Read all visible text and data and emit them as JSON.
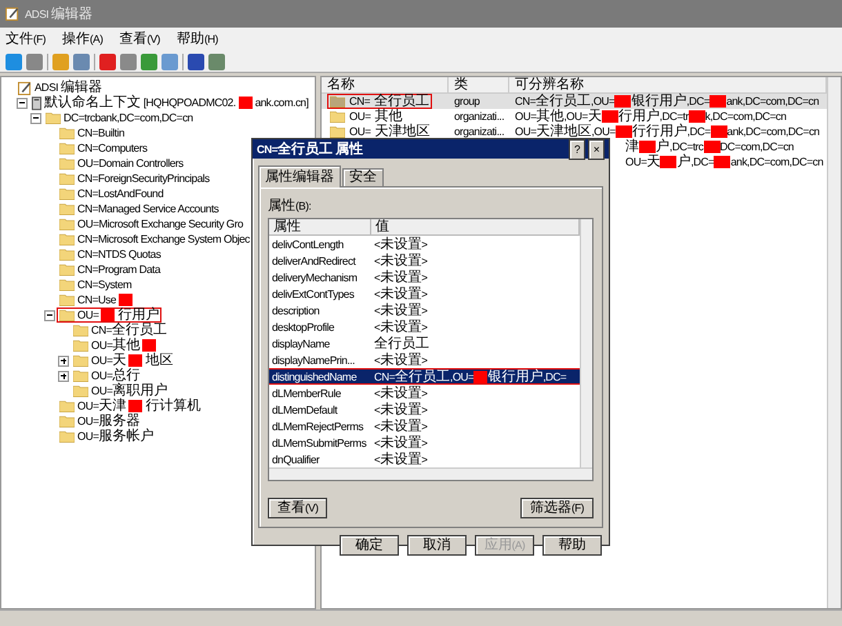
{
  "window": {
    "title": "ADSI 编辑器"
  },
  "menu": [
    "文件(F)",
    "操作(A)",
    "查看(V)",
    "帮助(H)"
  ],
  "tree": {
    "label": [
      "ADSI 编辑器"
    ],
    "kind": "root",
    "children": [
      {
        "label": [
          "默认命名上下文 [HQHQPOADMC02.",
          "ank.com.cn]"
        ],
        "kind": "server",
        "expanded": true,
        "children": [
          {
            "label": [
              "DC=trcbank,DC=com,DC=cn"
            ],
            "kind": "folder",
            "expanded": true,
            "children": [
              {
                "label": [
                  "CN=Builtin"
                ],
                "kind": "folder"
              },
              {
                "label": [
                  "CN=Computers"
                ],
                "kind": "folder"
              },
              {
                "label": [
                  "OU=Domain Controllers"
                ],
                "kind": "folder"
              },
              {
                "label": [
                  "CN=ForeignSecurityPrincipals"
                ],
                "kind": "folder"
              },
              {
                "label": [
                  "CN=LostAndFound"
                ],
                "kind": "folder"
              },
              {
                "label": [
                  "CN=Managed Service Accounts"
                ],
                "kind": "folder"
              },
              {
                "label": [
                  "OU=Microsoft Exchange Security Gro"
                ],
                "kind": "folder"
              },
              {
                "label": [
                  "CN=Microsoft Exchange System Objec"
                ],
                "kind": "folder"
              },
              {
                "label": [
                  "CN=NTDS Quotas"
                ],
                "kind": "folder"
              },
              {
                "label": [
                  "CN=Program Data"
                ],
                "kind": "folder"
              },
              {
                "label": [
                  "CN=System"
                ],
                "kind": "folder"
              },
              {
                "label": [
                  "CN=Use"
                ],
                "redacted_tail": true,
                "kind": "folder"
              },
              {
                "label": [
                  "OU=",
                  "行用户"
                ],
                "kind": "folder",
                "expanded": true,
                "outlined": true,
                "children": [
                  {
                    "label": [
                      "CN=全行员工"
                    ],
                    "kind": "folder"
                  },
                  {
                    "label": [
                      "OU=其他"
                    ],
                    "redacted_tail": true,
                    "kind": "folder"
                  },
                  {
                    "label": [
                      "OU=天",
                      "地区"
                    ],
                    "kind": "folder",
                    "expanded": false
                  },
                  {
                    "label": [
                      "OU=总行"
                    ],
                    "kind": "folder",
                    "expanded": false
                  },
                  {
                    "label": [
                      "OU=离职用户"
                    ],
                    "kind": "folder"
                  }
                ]
              },
              {
                "label": [
                  "OU=天津",
                  "行计算机"
                ],
                "kind": "folder"
              },
              {
                "label": [
                  "OU=服务器"
                ],
                "kind": "folder"
              },
              {
                "label": [
                  "OU=服务帐户"
                ],
                "kind": "folder"
              }
            ]
          }
        ]
      }
    ]
  },
  "list": {
    "columns": [
      "名称",
      "类",
      "可分辨名称"
    ],
    "rows": [
      {
        "name": "CN=全行员工",
        "class": "group",
        "dn": [
          "CN=全行员工,OU=",
          "银行用户,DC=",
          "ank,DC=com,DC=cn"
        ],
        "selected": true,
        "outlined": true
      },
      {
        "name": "OU=其他",
        "class": "organizati...",
        "dn": [
          "OU=其他,OU=天",
          "行用户,DC=tr",
          "k,DC=com,DC=cn"
        ],
        "selected": false,
        "outlined": false
      },
      {
        "name": "OU=天津地区",
        "class": "organizati...",
        "dn": [
          "OU=天津地区,OU=",
          "行行用户,DC=",
          "ank,DC=com,DC=cn"
        ],
        "selected": false,
        "outlined": false
      },
      {
        "dn": [
          "津",
          "户,DC=trc",
          "DC=com,DC=cn"
        ],
        "selected": false
      },
      {
        "dn": [
          "OU=天",
          "户,DC=",
          "ank,DC=com,DC=cn"
        ],
        "selected": false
      }
    ]
  },
  "dialog": {
    "title": "CN=全行员工 属性",
    "help": "?",
    "close": "×",
    "tabs": [
      {
        "label": "属性编辑器",
        "selected": true
      },
      {
        "label": "安全",
        "selected": false
      }
    ],
    "attributes_label": "属性(B):",
    "columns": [
      "属性",
      "值"
    ],
    "rows": [
      {
        "attr": "delivContLength",
        "value": [
          "<未设置>"
        ],
        "selected": false
      },
      {
        "attr": "deliverAndRedirect",
        "value": [
          "<未设置>"
        ],
        "selected": false
      },
      {
        "attr": "deliveryMechanism",
        "value": [
          "<未设置>"
        ],
        "selected": false
      },
      {
        "attr": "delivExtContTypes",
        "value": [
          "<未设置>"
        ],
        "selected": false
      },
      {
        "attr": "description",
        "value": [
          "<未设置>"
        ],
        "selected": false
      },
      {
        "attr": "desktopProfile",
        "value": [
          "<未设置>"
        ],
        "selected": false
      },
      {
        "attr": "displayName",
        "value": [
          "全行员工"
        ],
        "selected": false
      },
      {
        "attr": "displayNamePrin...",
        "value": [
          "<未设置>"
        ],
        "selected": false
      },
      {
        "attr": "distinguishedName",
        "value": [
          "CN=全行员工,OU=",
          "银行用户,DC="
        ],
        "selected": true
      },
      {
        "attr": "dLMemberRule",
        "value": [
          "<未设置>"
        ],
        "selected": false
      },
      {
        "attr": "dLMemDefault",
        "value": [
          "<未设置>"
        ],
        "selected": false
      },
      {
        "attr": "dLMemRejectPerms",
        "value": [
          "<未设置>"
        ],
        "selected": false
      },
      {
        "attr": "dLMemSubmitPerms",
        "value": [
          "<未设置>"
        ],
        "selected": false
      },
      {
        "attr": "dnQualifier",
        "value": [
          "<未设置>"
        ],
        "selected": false
      }
    ],
    "view_button": "查看(V)",
    "filter_button": "筛选器(F)",
    "buttons": [
      {
        "label": "确定",
        "disabled": false
      },
      {
        "label": "取消",
        "disabled": false
      },
      {
        "label": "应用(A)",
        "disabled": true
      },
      {
        "label": "帮助",
        "disabled": false
      }
    ]
  }
}
